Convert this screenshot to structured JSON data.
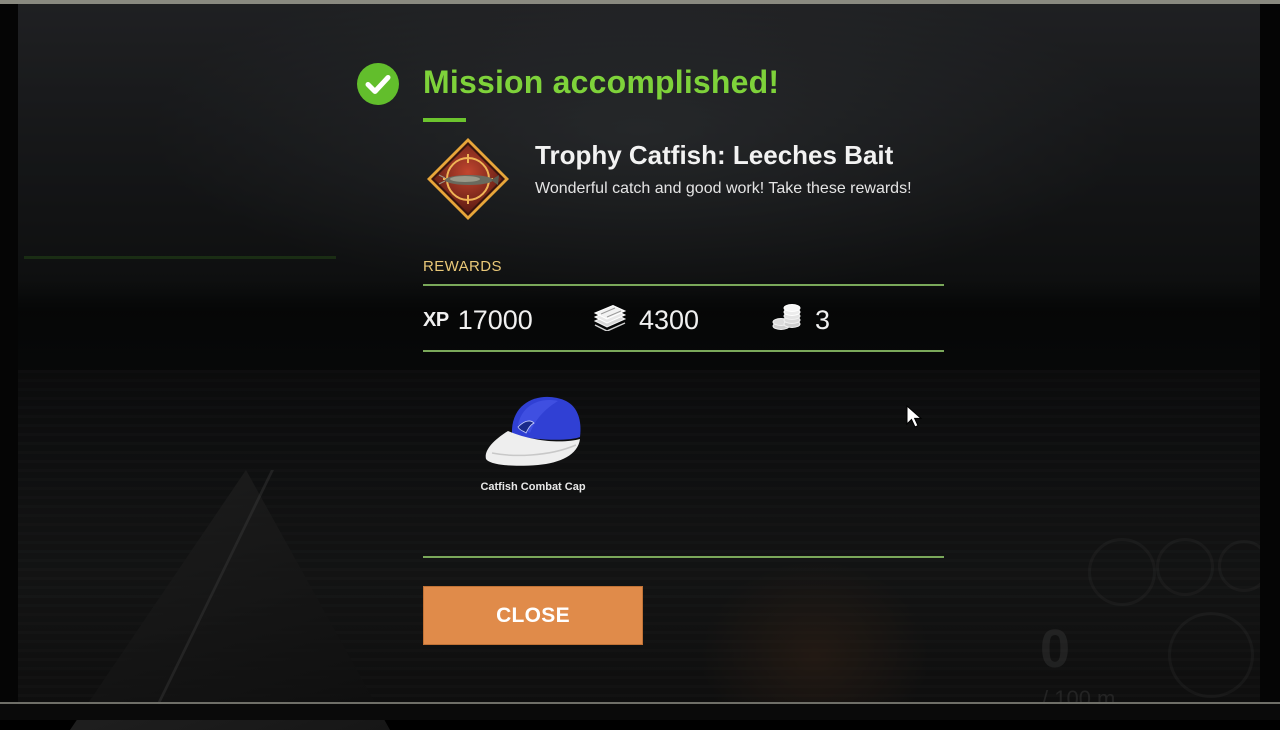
{
  "dialog": {
    "title": "Mission accomplished!",
    "mission_name": "Trophy Catfish: Leeches Bait",
    "mission_description": "Wonderful catch and good work! Take these rewards!",
    "badge_icon": "catfish-badge-icon",
    "rewards_label": "REWARDS",
    "rewards": [
      {
        "icon": "xp-icon",
        "icon_text": "XP",
        "value": "17000"
      },
      {
        "icon": "money-stack-icon",
        "value": "4300"
      },
      {
        "icon": "coin-stack-icon",
        "value": "3"
      }
    ],
    "item": {
      "icon": "cap-icon",
      "name": "Catfish Combat Cap"
    },
    "close_label": "CLOSE"
  },
  "hud": {
    "counter": "0",
    "distance": "/ 100 m"
  },
  "colors": {
    "title_green": "#7ed23a",
    "rewards_label": "#e9c878",
    "divider": "#7aa85a",
    "close_button": "#e08b4a",
    "cap_blue": "#2f3fd0"
  }
}
